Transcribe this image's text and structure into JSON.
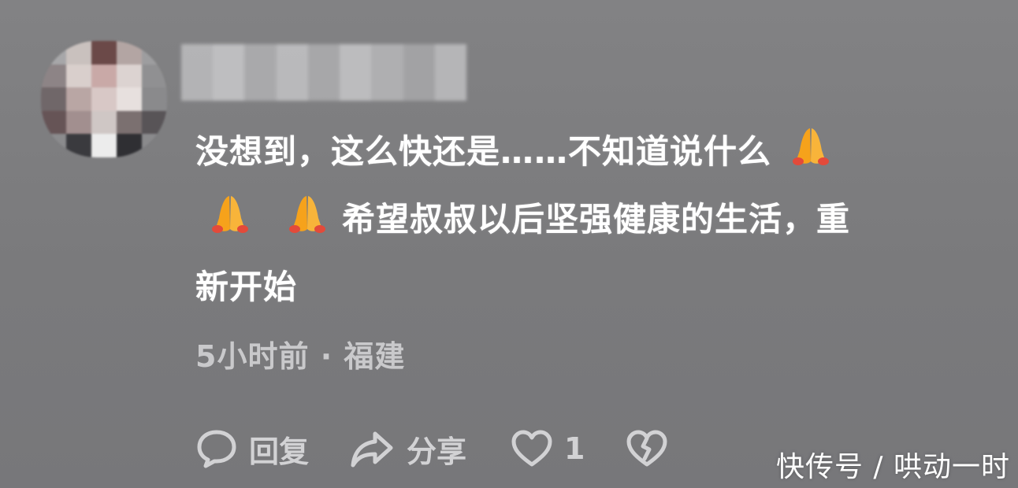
{
  "comment": {
    "line1_text": "没想到，这么快还是……不知道说什么",
    "line2_text": "希望叔叔以后坚强健康的生活，重",
    "line3_text": "新开始",
    "emoji_name": "folded-hands-emoji"
  },
  "meta": {
    "time": "5小时前",
    "separator": "·",
    "location": "福建"
  },
  "actions": {
    "reply_label": "回复",
    "share_label": "分享",
    "like_count": "1"
  },
  "watermark": {
    "text": "快传号 / 哄动一时"
  },
  "colors": {
    "background": "#7c7c7e",
    "text_primary": "#ffffff",
    "text_secondary": "#c9c9cb",
    "emoji_orange": "#f6a21b",
    "emoji_red": "#e34a3a"
  }
}
